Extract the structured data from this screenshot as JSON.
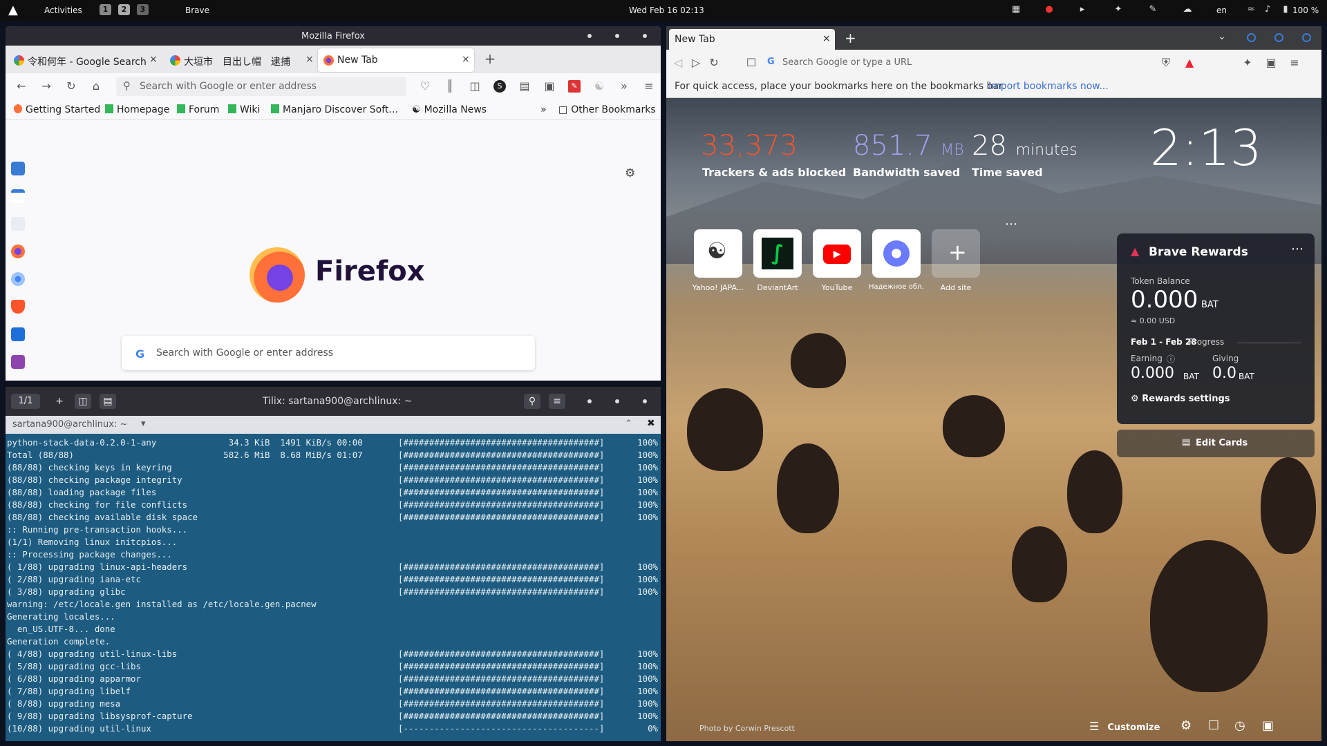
{
  "topbar": {
    "activities": "Activities",
    "workspaces": [
      "1",
      "2",
      "3"
    ],
    "app_name": "Brave",
    "clock": "Wed Feb 16  02:13",
    "lang": "en",
    "battery": "100 %"
  },
  "firefox": {
    "window_title": "Mozilla Firefox",
    "tabs": [
      {
        "label": "令和何年 - Google Search"
      },
      {
        "label": "大垣市　目出し帽　逮捕"
      },
      {
        "label": "New Tab"
      }
    ],
    "url_placeholder": "Search with Google or enter address",
    "bookmarks": [
      "Getting Started",
      "Homepage",
      "Forum",
      "Wiki",
      "Manjaro Discover Soft...",
      "Mozilla News"
    ],
    "other_bookmarks": "Other Bookmarks",
    "brand": "Firefox",
    "search_placeholder": "Search with Google or enter address"
  },
  "terminal": {
    "title": "Tilix: sartana900@archlinux: ~",
    "tab_counter": "1/1",
    "session": "sartana900@archlinux: ~",
    "lines": [
      {
        "text": "python-stack-data-0.2.0-1-any              34.3 KiB  1491 KiB/s 00:00",
        "bar": "[######################################]",
        "pct": "100%"
      },
      {
        "text": "Total (88/88)                             582.6 MiB  8.68 MiB/s 01:07",
        "bar": "[######################################]",
        "pct": "100%"
      },
      {
        "text": "(88/88) checking keys in keyring",
        "bar": "[######################################]",
        "pct": "100%"
      },
      {
        "text": "(88/88) checking package integrity",
        "bar": "[######################################]",
        "pct": "100%"
      },
      {
        "text": "(88/88) loading package files",
        "bar": "[######################################]",
        "pct": "100%"
      },
      {
        "text": "(88/88) checking for file conflicts",
        "bar": "[######################################]",
        "pct": "100%"
      },
      {
        "text": "(88/88) checking available disk space",
        "bar": "[######################################]",
        "pct": "100%"
      },
      {
        "text": ":: Running pre-transaction hooks...",
        "bar": "",
        "pct": ""
      },
      {
        "text": "(1/1) Removing linux initcpios...",
        "bar": "",
        "pct": ""
      },
      {
        "text": ":: Processing package changes...",
        "bar": "",
        "pct": ""
      },
      {
        "text": "( 1/88) upgrading linux-api-headers",
        "bar": "[######################################]",
        "pct": "100%"
      },
      {
        "text": "( 2/88) upgrading iana-etc",
        "bar": "[######################################]",
        "pct": "100%"
      },
      {
        "text": "( 3/88) upgrading glibc",
        "bar": "[######################################]",
        "pct": "100%"
      },
      {
        "text": "warning: /etc/locale.gen installed as /etc/locale.gen.pacnew",
        "bar": "",
        "pct": ""
      },
      {
        "text": "Generating locales...",
        "bar": "",
        "pct": ""
      },
      {
        "text": "  en_US.UTF-8... done",
        "bar": "",
        "pct": ""
      },
      {
        "text": "Generation complete.",
        "bar": "",
        "pct": ""
      },
      {
        "text": "( 4/88) upgrading util-linux-libs",
        "bar": "[######################################]",
        "pct": "100%"
      },
      {
        "text": "( 5/88) upgrading gcc-libs",
        "bar": "[######################################]",
        "pct": "100%"
      },
      {
        "text": "( 6/88) upgrading apparmor",
        "bar": "[######################################]",
        "pct": "100%"
      },
      {
        "text": "( 7/88) upgrading libelf",
        "bar": "[######################################]",
        "pct": "100%"
      },
      {
        "text": "( 8/88) upgrading mesa",
        "bar": "[######################################]",
        "pct": "100%"
      },
      {
        "text": "( 9/88) upgrading libsysprof-capture",
        "bar": "[######################################]",
        "pct": "100%"
      },
      {
        "text": "(10/88) upgrading util-linux",
        "bar": "[--------------------------------------]",
        "pct": "0%"
      }
    ]
  },
  "brave": {
    "tab_label": "New Tab",
    "url_placeholder": "Search Google or type a URL",
    "bookmarks_hint": "For quick access, place your bookmarks here on the bookmarks bar.",
    "import_link": "Import bookmarks now...",
    "stats": [
      {
        "value": "33,373",
        "unit": "",
        "label": "Trackers & ads blocked",
        "color": "#fb542b"
      },
      {
        "value": "851.7",
        "unit": "MB",
        "label": "Bandwidth saved",
        "color": "#a0a5eb"
      },
      {
        "value": "28",
        "unit": "minutes",
        "label": "Time saved",
        "color": "#ffffff"
      }
    ],
    "clock": "2:13",
    "top_sites": [
      {
        "label": "Yahoo! JAPA...",
        "icon": "globe-icon"
      },
      {
        "label": "DeviantArt",
        "icon": "deviantart-icon"
      },
      {
        "label": "YouTube",
        "icon": "youtube-icon"
      },
      {
        "label": "Надежное обл...",
        "icon": "cloud-icon"
      },
      {
        "label": "Add site",
        "icon": "plus-icon"
      }
    ],
    "rewards": {
      "title": "Brave Rewards",
      "token_balance_label": "Token Balance",
      "token_balance": "0.000",
      "bat": "BAT",
      "usd": "≈ 0.00 USD",
      "period": "Feb 1 - Feb 28",
      "progress": "Progress",
      "earning_label": "Earning",
      "earning": "0.000",
      "giving_label": "Giving",
      "giving": "0.0",
      "settings": "Rewards settings",
      "edit_cards": "Edit Cards"
    },
    "photo_by": "Photo by",
    "photographer": "Corwin Prescott",
    "customize": "Customize"
  }
}
